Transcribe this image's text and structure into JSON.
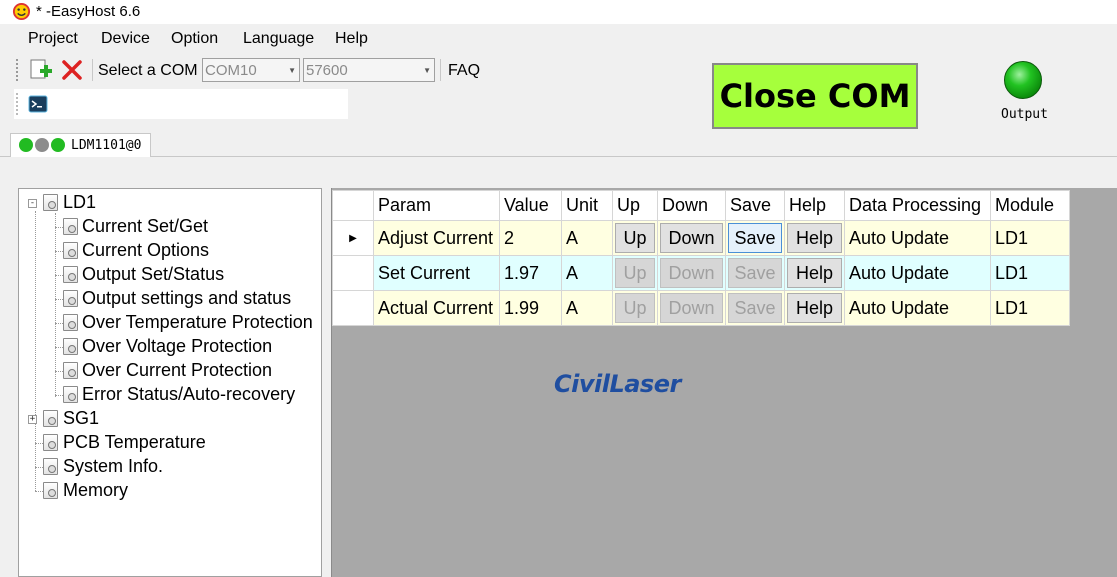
{
  "window": {
    "title": "* -EasyHost 6.6"
  },
  "menu": [
    "Project",
    "Device",
    "Option",
    "Language",
    "Help"
  ],
  "toolbar": {
    "com_label": "Select a COM",
    "com_value": "COM10",
    "baud_value": "57600",
    "faq_label": "FAQ",
    "close_com_label": "Close COM",
    "output_label": "Output"
  },
  "device_tab": {
    "label": "LDM1101@0",
    "leds": [
      "#22bb22",
      "#8c8c8c",
      "#22bb22"
    ]
  },
  "tree": {
    "root": "LD1",
    "children": [
      "Current Set/Get",
      "Current Options",
      "Output Set/Status",
      "Output settings and status",
      "Over Temperature Protection",
      "Over Voltage Protection",
      "Over Current Protection",
      "Error Status/Auto-recovery"
    ],
    "others": [
      "SG1",
      "PCB Temperature",
      "System Info.",
      "Memory"
    ]
  },
  "grid": {
    "columns": [
      "Param",
      "Value",
      "Unit",
      "Up",
      "Down",
      "Save",
      "Help",
      "Data Processing",
      "Module"
    ],
    "rows": [
      {
        "param": "Adjust Current",
        "value": "2",
        "unit": "A",
        "up": "Up",
        "down": "Down",
        "save": "Save",
        "help": "Help",
        "processing": "Auto Update",
        "module": "LD1"
      },
      {
        "param": "Set Current",
        "value": "1.97",
        "unit": "A",
        "up": "Up",
        "down": "Down",
        "save": "Save",
        "help": "Help",
        "processing": "Auto Update",
        "module": "LD1"
      },
      {
        "param": "Actual Current",
        "value": "1.99",
        "unit": "A",
        "up": "Up",
        "down": "Down",
        "save": "Save",
        "help": "Help",
        "processing": "Auto Update",
        "module": "LD1"
      }
    ]
  },
  "logo": "CivilLaser",
  "colors": {
    "close_com_bg": "#a6ff3c",
    "led_green": "#22bb22",
    "row_yellow": "#ffffe1",
    "row_cyan": "#e0ffff"
  }
}
